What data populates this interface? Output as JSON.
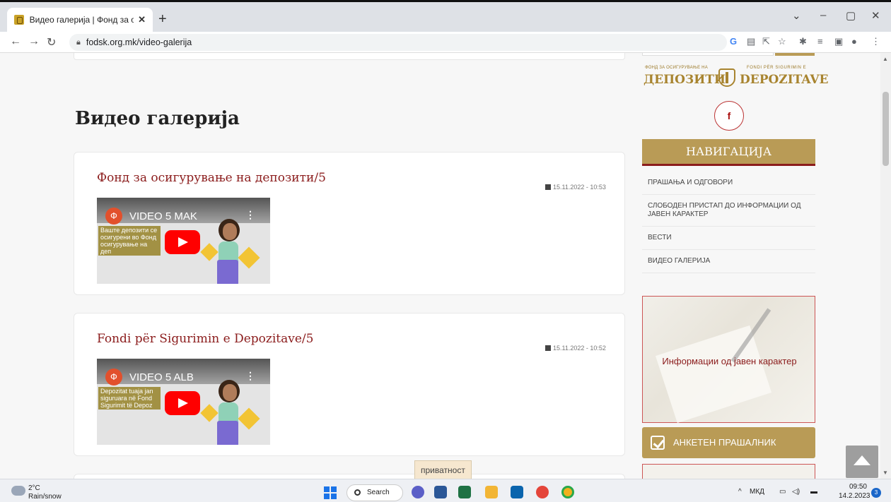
{
  "browser": {
    "tab_title": "Видео галерија | Фонд за осигу",
    "tab_close": "✕",
    "new_tab": "+",
    "url": "fodsk.org.mk/video-galerija",
    "window_controls": [
      "⌄",
      "–",
      "▢",
      "✕"
    ]
  },
  "page": {
    "title": "Видео галерија"
  },
  "videos": [
    {
      "title": "Фонд за осигурување на депозити/5",
      "date": "15.11.2022 - 10:53",
      "thumb_name": "VIDEO 5 MAK",
      "thumb_text": "Ваште депозити се осигурени во Фонд осигурување на деп"
    },
    {
      "title": "Fondi për Sigurimin e Depozitave/5",
      "date": "15.11.2022 - 10:52",
      "thumb_name": "VIDEO 5 ALB",
      "thumb_text": "Depozitat tuaja jan siguruara në Fond Sigurimit të Depoz"
    }
  ],
  "privacy": "приватност",
  "sidebar": {
    "logo_small_left": "ФОНД ЗА ОСИГУРУВАЊЕ НА",
    "logo_big_left": "ДЕПОЗИТИ",
    "logo_small_right": "FONDI PËR SIGURIMIN E",
    "logo_big_right": "DEPOZITAVE",
    "facebook": "f",
    "nav_heading": "НАВИГАЦИЈА",
    "nav_items": [
      "ПРАШАЊА И ОДГОВОРИ",
      "СЛОБОДЕН ПРИСТАП ДО ИНФОРМАЦИИ ОД ЈАВЕН КАРАКТЕР",
      "ВЕСТИ",
      "ВИДЕО ГАЛЕРИЈА"
    ],
    "info_label": "Информации од јавен карактер",
    "survey": "АНКЕТЕН ПРАШАЛНИК"
  },
  "taskbar": {
    "temp": "2°C",
    "weather": "Rain/snow",
    "search": "Search",
    "lang": "МКД",
    "time": "09:50",
    "date": "14.2.2023",
    "notifications": "3"
  },
  "colors": {
    "accent_gold": "#b99b56",
    "accent_red": "#8b1c1c"
  }
}
